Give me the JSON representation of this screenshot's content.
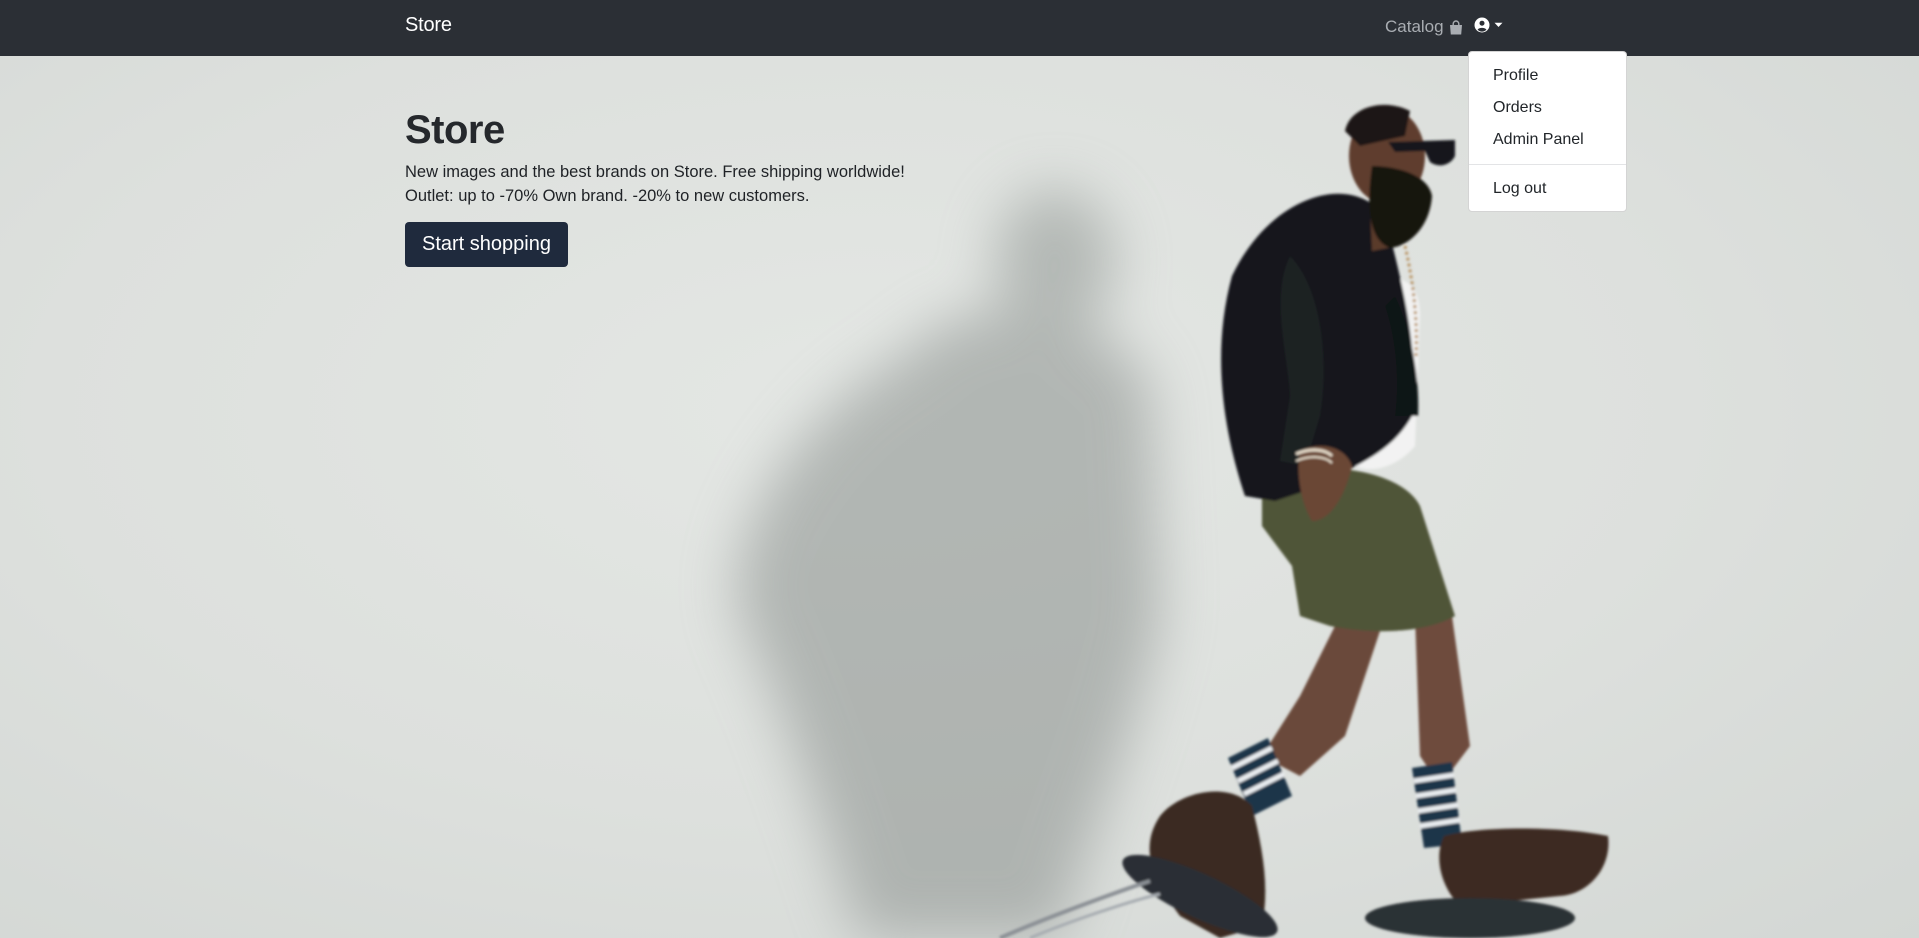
{
  "navbar": {
    "brand": "Store",
    "catalog_label": "Catalog",
    "catalog_icon": "shopping-bag-icon",
    "user_icon": "user-circle-icon",
    "caret_icon": "caret-down-icon"
  },
  "user_menu": {
    "items": [
      {
        "label": "Profile"
      },
      {
        "label": "Orders"
      },
      {
        "label": "Admin Panel"
      }
    ],
    "logout_label": "Log out"
  },
  "hero": {
    "title": "Store",
    "lead_line1": "New images and the best brands on Store. Free shipping worldwide!",
    "lead_line2": "Outlet: up to -70% Own brand. -20% to new customers.",
    "cta_label": "Start shopping"
  },
  "colors": {
    "navbar_bg": "#2b2f35",
    "cta_bg": "#1f2a3d",
    "hero_bg": "#dfe2df"
  }
}
